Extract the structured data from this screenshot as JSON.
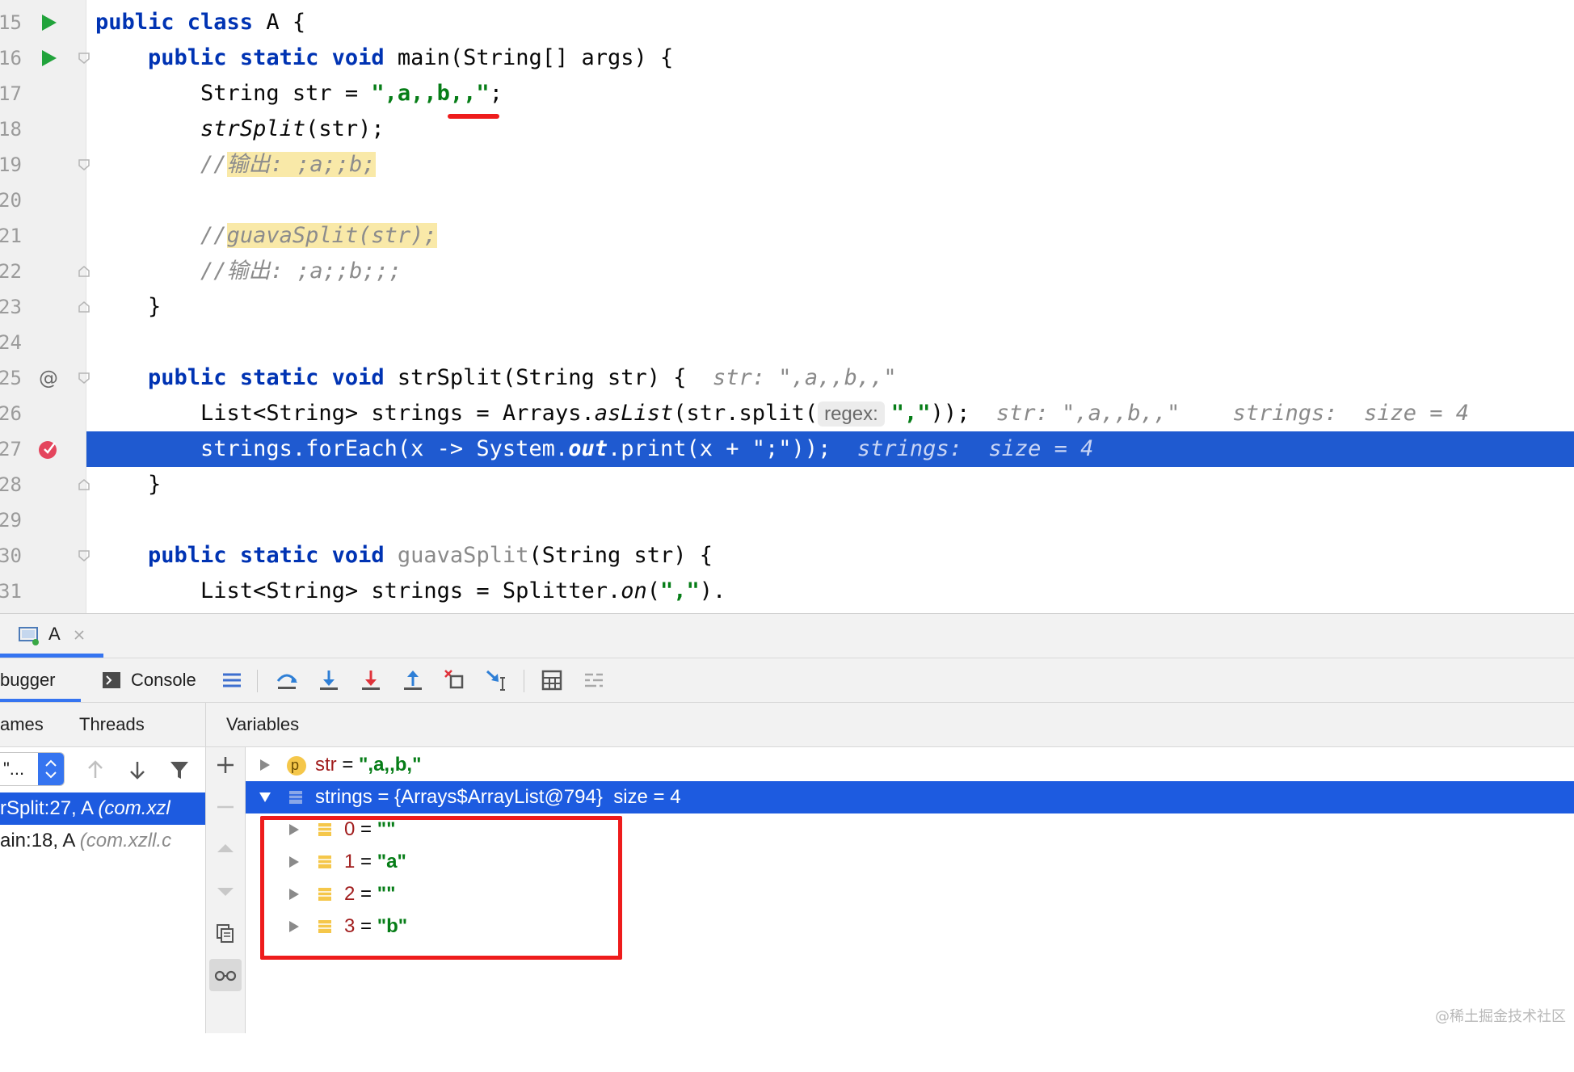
{
  "editor": {
    "lines": [
      {
        "num": "15"
      },
      {
        "num": "16"
      },
      {
        "num": "17"
      },
      {
        "num": "18"
      },
      {
        "num": "19"
      },
      {
        "num": "20"
      },
      {
        "num": "21"
      },
      {
        "num": "22"
      },
      {
        "num": "23"
      },
      {
        "num": "24"
      },
      {
        "num": "25"
      },
      {
        "num": "26"
      },
      {
        "num": "27"
      },
      {
        "num": "28"
      },
      {
        "num": "29"
      },
      {
        "num": "30"
      },
      {
        "num": "31"
      }
    ],
    "t": {
      "l15_kw": "public class",
      "l15_rest": " A {",
      "l16_ind": "    ",
      "l16_kw": "public static void",
      "l16_rest": " main(String[] args) {",
      "l17_pre": "        String str = ",
      "l17_str": "\",a,,b,,\"",
      "l17_post": ";",
      "l18_ind": "        ",
      "l18_fn": "strSplit",
      "l18_rest": "(str);",
      "l19_ind": "        ",
      "l19_cmt": "//",
      "l19_hl": "输出: ;a;;b;",
      "l21_ind": "        ",
      "l21_cmt": "//",
      "l21_hl": "guavaSplit(str);",
      "l22_ind": "        ",
      "l22_cmt": "//输出: ;a;;b;;;",
      "l23_code": "    }",
      "l25_ind": "    ",
      "l25_kw": "public static void",
      "l25_rest": " strSplit(String str) {  ",
      "l25_hint": "str: \",a,,b,,\"",
      "l26_pre": "        List<String> strings = Arrays.",
      "l26_fn": "asList",
      "l26_mid": "(str.split(",
      "l26_param": "regex:",
      "l26_str": "\",\"",
      "l26_post": "));  ",
      "l26_hint": "str: \",a,,b,,\"    strings:  size = 4",
      "l27_pre": "        strings.forEach(x -> System.",
      "l27_out": "out",
      "l27_mid": ".print(x + \";\"));  ",
      "l27_hint": "strings:  size = 4",
      "l28_code": "    }",
      "l30_ind": "    ",
      "l30_kw": "public static void",
      "l30_sp": " ",
      "l30_fn": "guavaSplit",
      "l30_rest": "(String str) {",
      "l31_pre": "        List<String> strings = Splitter.",
      "l31_fn": "on",
      "l31_p1": "(",
      "l31_str": "\",\"",
      "l31_p2": ")."
    }
  },
  "toolwindow": {
    "run_tab": "A",
    "tabs": {
      "debugger": "bugger",
      "console": "Console"
    },
    "subtabs": {
      "frames": "ames",
      "threads": "Threads",
      "variables": "Variables"
    },
    "thread_select": "\"...",
    "frames": [
      {
        "text": "rSplit:27, A",
        "pkg": "(com.xzl"
      },
      {
        "text": "ain:18, A",
        "pkg": "(com.xzll.c"
      }
    ],
    "variables": {
      "str": {
        "badge": "p",
        "name": "str",
        "eq": " = ",
        "value": "\",a,,b,\""
      },
      "strings": {
        "name": "strings",
        "eq": " = ",
        "value": "{Arrays$ArrayList@794}",
        "size": "  size = 4"
      },
      "items": [
        {
          "index": "0",
          "eq": " = ",
          "value": "\"\""
        },
        {
          "index": "1",
          "eq": " = ",
          "value": "\"a\""
        },
        {
          "index": "2",
          "eq": " = ",
          "value": "\"\""
        },
        {
          "index": "3",
          "eq": " = ",
          "value": "\"b\""
        }
      ]
    }
  },
  "watermark": "@稀土掘金技术社区",
  "colors": {
    "accent": "#2154c1",
    "selection": "#1d5be0",
    "annotation": "#ee1c1c",
    "string": "#067d17",
    "keyword": "#0033b3"
  }
}
